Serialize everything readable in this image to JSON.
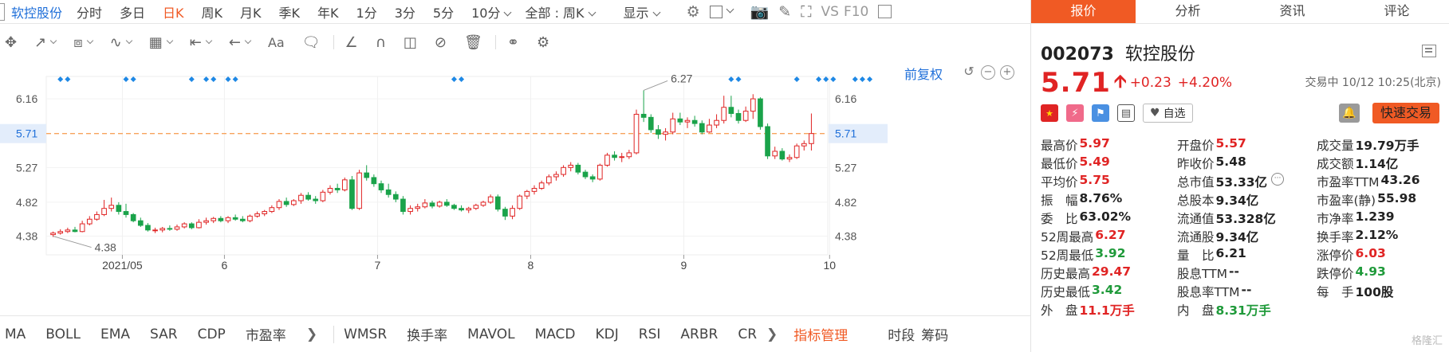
{
  "toolbar": {
    "stock_name": "软控股份",
    "periods": [
      "分时",
      "多日",
      "日K",
      "周K",
      "月K",
      "季K",
      "年K",
      "1分",
      "3分",
      "5分",
      "10分"
    ],
    "active_period": "日K",
    "range_select": "全部 : 周K",
    "display_label": "显示",
    "vs_label": "VS",
    "f10_label": "F10"
  },
  "drawing_tools": {
    "text_tool": "Aa"
  },
  "chart": {
    "restore_label": "前复权",
    "price_ticks": [
      "6.16",
      "5.71",
      "5.27",
      "4.82",
      "4.38"
    ],
    "date_ticks": [
      "2021/05",
      "6",
      "7",
      "8",
      "9",
      "10"
    ],
    "high_label": "6.27",
    "low_label": "4.38",
    "current_line": "5.71",
    "colors": {
      "up": "#e02424",
      "down": "#1aa34a",
      "current_line": "#f7a35c",
      "marker": "#1e88e5",
      "current_tag_bg": "#e3edfb",
      "current_tag_text": "#1f6fd9"
    }
  },
  "chart_data": {
    "type": "candlestick",
    "title": "",
    "xlabel": "",
    "ylabel": "",
    "ylim": [
      4.2,
      6.45
    ],
    "candles": [
      {
        "o": 4.4,
        "h": 4.44,
        "l": 4.37,
        "c": 4.42
      },
      {
        "o": 4.42,
        "h": 4.47,
        "l": 4.4,
        "c": 4.44
      },
      {
        "o": 4.44,
        "h": 4.49,
        "l": 4.42,
        "c": 4.46
      },
      {
        "o": 4.46,
        "h": 4.5,
        "l": 4.43,
        "c": 4.44
      },
      {
        "o": 4.44,
        "h": 4.58,
        "l": 4.43,
        "c": 4.54
      },
      {
        "o": 4.54,
        "h": 4.64,
        "l": 4.52,
        "c": 4.6
      },
      {
        "o": 4.6,
        "h": 4.7,
        "l": 4.58,
        "c": 4.66
      },
      {
        "o": 4.66,
        "h": 4.85,
        "l": 4.64,
        "c": 4.74
      },
      {
        "o": 4.74,
        "h": 4.88,
        "l": 4.7,
        "c": 4.78
      },
      {
        "o": 4.78,
        "h": 4.82,
        "l": 4.66,
        "c": 4.7
      },
      {
        "o": 4.7,
        "h": 4.8,
        "l": 4.62,
        "c": 4.66
      },
      {
        "o": 4.66,
        "h": 4.68,
        "l": 4.56,
        "c": 4.58
      },
      {
        "o": 4.58,
        "h": 4.62,
        "l": 4.5,
        "c": 4.52
      },
      {
        "o": 4.52,
        "h": 4.55,
        "l": 4.44,
        "c": 4.46
      },
      {
        "o": 4.46,
        "h": 4.49,
        "l": 4.42,
        "c": 4.46
      },
      {
        "o": 4.46,
        "h": 4.5,
        "l": 4.43,
        "c": 4.48
      },
      {
        "o": 4.48,
        "h": 4.52,
        "l": 4.45,
        "c": 4.47
      },
      {
        "o": 4.47,
        "h": 4.53,
        "l": 4.45,
        "c": 4.5
      },
      {
        "o": 4.5,
        "h": 4.56,
        "l": 4.48,
        "c": 4.54
      },
      {
        "o": 4.54,
        "h": 4.56,
        "l": 4.47,
        "c": 4.49
      },
      {
        "o": 4.49,
        "h": 4.6,
        "l": 4.48,
        "c": 4.56
      },
      {
        "o": 4.56,
        "h": 4.62,
        "l": 4.53,
        "c": 4.58
      },
      {
        "o": 4.58,
        "h": 4.63,
        "l": 4.55,
        "c": 4.61
      },
      {
        "o": 4.61,
        "h": 4.64,
        "l": 4.56,
        "c": 4.58
      },
      {
        "o": 4.58,
        "h": 4.64,
        "l": 4.55,
        "c": 4.62
      },
      {
        "o": 4.62,
        "h": 4.66,
        "l": 4.58,
        "c": 4.6
      },
      {
        "o": 4.6,
        "h": 4.64,
        "l": 4.56,
        "c": 4.58
      },
      {
        "o": 4.58,
        "h": 4.66,
        "l": 4.56,
        "c": 4.64
      },
      {
        "o": 4.64,
        "h": 4.7,
        "l": 4.62,
        "c": 4.67
      },
      {
        "o": 4.67,
        "h": 4.72,
        "l": 4.64,
        "c": 4.7
      },
      {
        "o": 4.7,
        "h": 4.78,
        "l": 4.68,
        "c": 4.75
      },
      {
        "o": 4.75,
        "h": 4.86,
        "l": 4.72,
        "c": 4.83
      },
      {
        "o": 4.83,
        "h": 4.88,
        "l": 4.76,
        "c": 4.79
      },
      {
        "o": 4.79,
        "h": 4.86,
        "l": 4.77,
        "c": 4.84
      },
      {
        "o": 4.84,
        "h": 4.94,
        "l": 4.8,
        "c": 4.91
      },
      {
        "o": 4.91,
        "h": 4.95,
        "l": 4.84,
        "c": 4.86
      },
      {
        "o": 4.86,
        "h": 4.9,
        "l": 4.8,
        "c": 4.84
      },
      {
        "o": 4.84,
        "h": 4.98,
        "l": 4.82,
        "c": 4.95
      },
      {
        "o": 4.95,
        "h": 5.04,
        "l": 4.92,
        "c": 5.0
      },
      {
        "o": 5.0,
        "h": 5.06,
        "l": 4.94,
        "c": 4.98
      },
      {
        "o": 4.98,
        "h": 5.14,
        "l": 4.96,
        "c": 5.11
      },
      {
        "o": 5.11,
        "h": 5.16,
        "l": 4.72,
        "c": 4.74
      },
      {
        "o": 4.74,
        "h": 5.24,
        "l": 4.72,
        "c": 5.2
      },
      {
        "o": 5.2,
        "h": 5.3,
        "l": 5.1,
        "c": 5.14
      },
      {
        "o": 5.14,
        "h": 5.18,
        "l": 5.02,
        "c": 5.06
      },
      {
        "o": 5.06,
        "h": 5.1,
        "l": 4.94,
        "c": 4.98
      },
      {
        "o": 4.98,
        "h": 5.06,
        "l": 4.88,
        "c": 4.92
      },
      {
        "o": 4.92,
        "h": 4.96,
        "l": 4.82,
        "c": 4.86
      },
      {
        "o": 4.86,
        "h": 4.9,
        "l": 4.66,
        "c": 4.7
      },
      {
        "o": 4.7,
        "h": 4.78,
        "l": 4.66,
        "c": 4.74
      },
      {
        "o": 4.74,
        "h": 4.8,
        "l": 4.7,
        "c": 4.76
      },
      {
        "o": 4.76,
        "h": 4.86,
        "l": 4.74,
        "c": 4.81
      },
      {
        "o": 4.81,
        "h": 4.84,
        "l": 4.74,
        "c": 4.77
      },
      {
        "o": 4.77,
        "h": 4.84,
        "l": 4.75,
        "c": 4.82
      },
      {
        "o": 4.82,
        "h": 4.86,
        "l": 4.76,
        "c": 4.78
      },
      {
        "o": 4.78,
        "h": 4.8,
        "l": 4.72,
        "c": 4.74
      },
      {
        "o": 4.74,
        "h": 4.78,
        "l": 4.7,
        "c": 4.72
      },
      {
        "o": 4.72,
        "h": 4.76,
        "l": 4.68,
        "c": 4.74
      },
      {
        "o": 4.74,
        "h": 4.8,
        "l": 4.72,
        "c": 4.78
      },
      {
        "o": 4.78,
        "h": 4.84,
        "l": 4.76,
        "c": 4.82
      },
      {
        "o": 4.82,
        "h": 4.92,
        "l": 4.8,
        "c": 4.89
      },
      {
        "o": 4.89,
        "h": 4.92,
        "l": 4.7,
        "c": 4.73
      },
      {
        "o": 4.73,
        "h": 4.76,
        "l": 4.59,
        "c": 4.64
      },
      {
        "o": 4.64,
        "h": 4.78,
        "l": 4.6,
        "c": 4.74
      },
      {
        "o": 4.74,
        "h": 4.92,
        "l": 4.72,
        "c": 4.9
      },
      {
        "o": 4.9,
        "h": 4.98,
        "l": 4.86,
        "c": 4.96
      },
      {
        "o": 4.96,
        "h": 5.04,
        "l": 4.92,
        "c": 5.0
      },
      {
        "o": 5.0,
        "h": 5.1,
        "l": 4.98,
        "c": 5.07
      },
      {
        "o": 5.07,
        "h": 5.18,
        "l": 5.04,
        "c": 5.15
      },
      {
        "o": 5.15,
        "h": 5.22,
        "l": 5.1,
        "c": 5.18
      },
      {
        "o": 5.18,
        "h": 5.3,
        "l": 5.15,
        "c": 5.27
      },
      {
        "o": 5.27,
        "h": 5.34,
        "l": 5.22,
        "c": 5.3
      },
      {
        "o": 5.3,
        "h": 5.33,
        "l": 5.18,
        "c": 5.21
      },
      {
        "o": 5.21,
        "h": 5.24,
        "l": 5.12,
        "c": 5.15
      },
      {
        "o": 5.15,
        "h": 5.18,
        "l": 5.08,
        "c": 5.12
      },
      {
        "o": 5.12,
        "h": 5.32,
        "l": 5.1,
        "c": 5.3
      },
      {
        "o": 5.3,
        "h": 5.46,
        "l": 5.28,
        "c": 5.43
      },
      {
        "o": 5.43,
        "h": 5.48,
        "l": 5.36,
        "c": 5.4
      },
      {
        "o": 5.4,
        "h": 5.46,
        "l": 5.34,
        "c": 5.41
      },
      {
        "o": 5.41,
        "h": 5.5,
        "l": 5.38,
        "c": 5.46
      },
      {
        "o": 5.46,
        "h": 6.02,
        "l": 5.44,
        "c": 5.96
      },
      {
        "o": 5.96,
        "h": 6.27,
        "l": 5.86,
        "c": 5.92
      },
      {
        "o": 5.92,
        "h": 5.96,
        "l": 5.72,
        "c": 5.76
      },
      {
        "o": 5.76,
        "h": 5.82,
        "l": 5.64,
        "c": 5.7
      },
      {
        "o": 5.7,
        "h": 5.78,
        "l": 5.62,
        "c": 5.73
      },
      {
        "o": 5.73,
        "h": 5.98,
        "l": 5.7,
        "c": 5.9
      },
      {
        "o": 5.9,
        "h": 5.98,
        "l": 5.82,
        "c": 5.86
      },
      {
        "o": 5.86,
        "h": 5.92,
        "l": 5.78,
        "c": 5.88
      },
      {
        "o": 5.88,
        "h": 5.94,
        "l": 5.8,
        "c": 5.84
      },
      {
        "o": 5.84,
        "h": 5.88,
        "l": 5.7,
        "c": 5.73
      },
      {
        "o": 5.73,
        "h": 5.9,
        "l": 5.72,
        "c": 5.82
      },
      {
        "o": 5.82,
        "h": 5.96,
        "l": 5.78,
        "c": 5.88
      },
      {
        "o": 5.88,
        "h": 6.2,
        "l": 5.84,
        "c": 6.05
      },
      {
        "o": 6.05,
        "h": 6.2,
        "l": 5.92,
        "c": 5.97
      },
      {
        "o": 5.97,
        "h": 6.02,
        "l": 5.84,
        "c": 5.88
      },
      {
        "o": 5.88,
        "h": 6.06,
        "l": 5.86,
        "c": 6.0
      },
      {
        "o": 6.0,
        "h": 6.22,
        "l": 5.9,
        "c": 6.16
      },
      {
        "o": 6.16,
        "h": 6.18,
        "l": 5.76,
        "c": 5.8
      },
      {
        "o": 5.8,
        "h": 5.84,
        "l": 5.38,
        "c": 5.42
      },
      {
        "o": 5.42,
        "h": 5.54,
        "l": 5.38,
        "c": 5.48
      },
      {
        "o": 5.48,
        "h": 5.52,
        "l": 5.36,
        "c": 5.38
      },
      {
        "o": 5.38,
        "h": 5.44,
        "l": 5.34,
        "c": 5.4
      },
      {
        "o": 5.4,
        "h": 5.58,
        "l": 5.38,
        "c": 5.55
      },
      {
        "o": 5.55,
        "h": 5.62,
        "l": 5.49,
        "c": 5.58
      },
      {
        "o": 5.58,
        "h": 5.97,
        "l": 5.49,
        "c": 5.71
      }
    ],
    "markers_at": [
      1,
      2,
      10,
      11,
      19,
      21,
      22,
      24,
      25,
      55,
      56,
      93,
      94,
      102,
      105,
      106,
      107,
      110,
      111,
      112
    ],
    "high": {
      "index": 81,
      "value": 6.27
    },
    "low": {
      "index": 0,
      "value": 4.38
    },
    "current_price": 5.71
  },
  "indicators": {
    "items": [
      "MA",
      "BOLL",
      "EMA",
      "SAR",
      "CDP",
      "市盈率"
    ],
    "items2": [
      "WMSR",
      "换手率",
      "MAVOL",
      "MACD",
      "KDJ",
      "RSI",
      "ARBR",
      "CR"
    ],
    "manage_label": "指标管理",
    "right_items": [
      "时段",
      "筹码"
    ]
  },
  "panel": {
    "tabs": [
      "报价",
      "分析",
      "资讯",
      "评论"
    ],
    "active_tab": "报价",
    "code": "002073",
    "name": "软控股份",
    "price": "5.71",
    "change": "+0.23",
    "change_pct": "+4.20%",
    "trade_status": "交易中 10/12 10:25(北京)",
    "watch_label": "自选",
    "quick_trade_label": "快速交易",
    "stats": [
      [
        {
          "label": "最高价",
          "value": "5.97",
          "color": "red"
        },
        {
          "label": "开盘价",
          "value": "5.57",
          "color": "red"
        },
        {
          "label": "成交量",
          "value": "19.79万手",
          "color": "dark"
        }
      ],
      [
        {
          "label": "最低价",
          "value": "5.49",
          "color": "red"
        },
        {
          "label": "昨收价",
          "value": "5.48",
          "color": "dark"
        },
        {
          "label": "成交额",
          "value": "1.14亿",
          "color": "dark"
        }
      ],
      [
        {
          "label": "平均价",
          "value": "5.75",
          "color": "red"
        },
        {
          "label": "总市值",
          "value": "53.33亿",
          "color": "dark",
          "more": true
        },
        {
          "label": "市盈率TTM",
          "value": "43.26",
          "color": "dark"
        }
      ],
      [
        {
          "label": "振　幅",
          "value": "8.76%",
          "color": "dark"
        },
        {
          "label": "总股本",
          "value": "9.34亿",
          "color": "dark"
        },
        {
          "label": "市盈率(静)",
          "value": "55.98",
          "color": "dark"
        }
      ],
      [
        {
          "label": "委　比",
          "value": "63.02%",
          "color": "dark"
        },
        {
          "label": "流通值",
          "value": "53.328亿",
          "color": "dark"
        },
        {
          "label": "市净率",
          "value": "1.239",
          "color": "dark"
        }
      ],
      [
        {
          "label": "52周最高",
          "value": "6.27",
          "color": "red"
        },
        {
          "label": "流通股",
          "value": "9.34亿",
          "color": "dark"
        },
        {
          "label": "换手率",
          "value": "2.12%",
          "color": "dark"
        }
      ],
      [
        {
          "label": "52周最低",
          "value": "3.92",
          "color": "green"
        },
        {
          "label": "量　比",
          "value": "6.21",
          "color": "dark"
        },
        {
          "label": "涨停价",
          "value": "6.03",
          "color": "red"
        }
      ],
      [
        {
          "label": "历史最高",
          "value": "29.47",
          "color": "red"
        },
        {
          "label": "股息TTM",
          "value": "--",
          "color": "dark"
        },
        {
          "label": "跌停价",
          "value": "4.93",
          "color": "green"
        }
      ],
      [
        {
          "label": "历史最低",
          "value": "3.42",
          "color": "green"
        },
        {
          "label": "股息率TTM",
          "value": "--",
          "color": "dark"
        },
        {
          "label": "每　手",
          "value": "100股",
          "color": "dark"
        }
      ],
      [
        {
          "label": "外　盘",
          "value": "11.1万手",
          "color": "red"
        },
        {
          "label": "内　盘",
          "value": "8.31万手",
          "color": "green"
        },
        {
          "label": "",
          "value": "",
          "color": "dark"
        }
      ]
    ]
  },
  "watermark": "格隆汇"
}
